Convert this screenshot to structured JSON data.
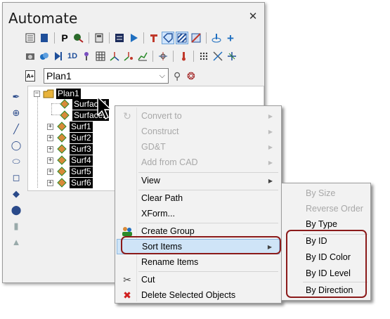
{
  "panel": {
    "title": "Automate",
    "close_symbol": "✕"
  },
  "toolbar": {
    "row1": [
      "properties-icon",
      "book-icon",
      "p-icon",
      "tools-icon",
      "calculator-icon",
      "list-icon",
      "play-icon",
      "robot-icon",
      "tag-icon",
      "hatch-icon",
      "hatch-blue-icon",
      "probe-icon",
      "plus-icon"
    ],
    "row2": [
      "camera-icon",
      "cloud-icon",
      "next-icon",
      "1d-icon",
      "tree-icon",
      "grid-icon",
      "axis-icon",
      "axis2-icon",
      "chart-icon",
      "alignment-icon",
      "thermometer-icon",
      "dots-icon",
      "cross-icon",
      "star-icon"
    ],
    "row2_text": "1D"
  },
  "plan_selector": {
    "value": "Plan1",
    "icon_label": "A+"
  },
  "tree": {
    "root": "Plan1",
    "children": [
      "Surface1",
      "Surface2",
      "Surf1",
      "Surf2",
      "Surf3",
      "Surf4",
      "Surf5",
      "Surf6"
    ]
  },
  "context_menu": {
    "items": [
      {
        "label": "Convert to",
        "enabled": false,
        "submenu": true
      },
      {
        "label": "Construct",
        "enabled": false,
        "submenu": true
      },
      {
        "label": "GD&T",
        "enabled": false,
        "submenu": true
      },
      {
        "label": "Add from CAD",
        "enabled": false,
        "submenu": true
      },
      {
        "label": "View",
        "enabled": true,
        "submenu": true
      },
      {
        "label": "Clear Path",
        "enabled": true
      },
      {
        "label": "XForm...",
        "enabled": true
      },
      {
        "label": "Create Group",
        "enabled": true,
        "icon": "group-icon"
      },
      {
        "label": "Sort Items",
        "enabled": true,
        "submenu": true,
        "highlighted": true
      },
      {
        "label": "Rename Items",
        "enabled": true
      },
      {
        "label": "Cut",
        "enabled": true,
        "icon": "scissors-icon"
      },
      {
        "label": "Delete Selected Objects",
        "enabled": true,
        "icon": "delete-icon"
      }
    ]
  },
  "sort_submenu": {
    "items": [
      {
        "label": "By Size",
        "enabled": false
      },
      {
        "label": "Reverse Order",
        "enabled": false
      },
      {
        "label": "By Type",
        "enabled": true
      },
      {
        "label": "By ID",
        "enabled": true
      },
      {
        "label": "By ID Color",
        "enabled": true
      },
      {
        "label": "By ID Level",
        "enabled": true
      },
      {
        "label": "By Direction",
        "enabled": true
      }
    ]
  },
  "colors": {
    "highlight": "#cfe4f7",
    "outline": "#8b1a1a",
    "disabled_text": "#a8a8a8"
  }
}
